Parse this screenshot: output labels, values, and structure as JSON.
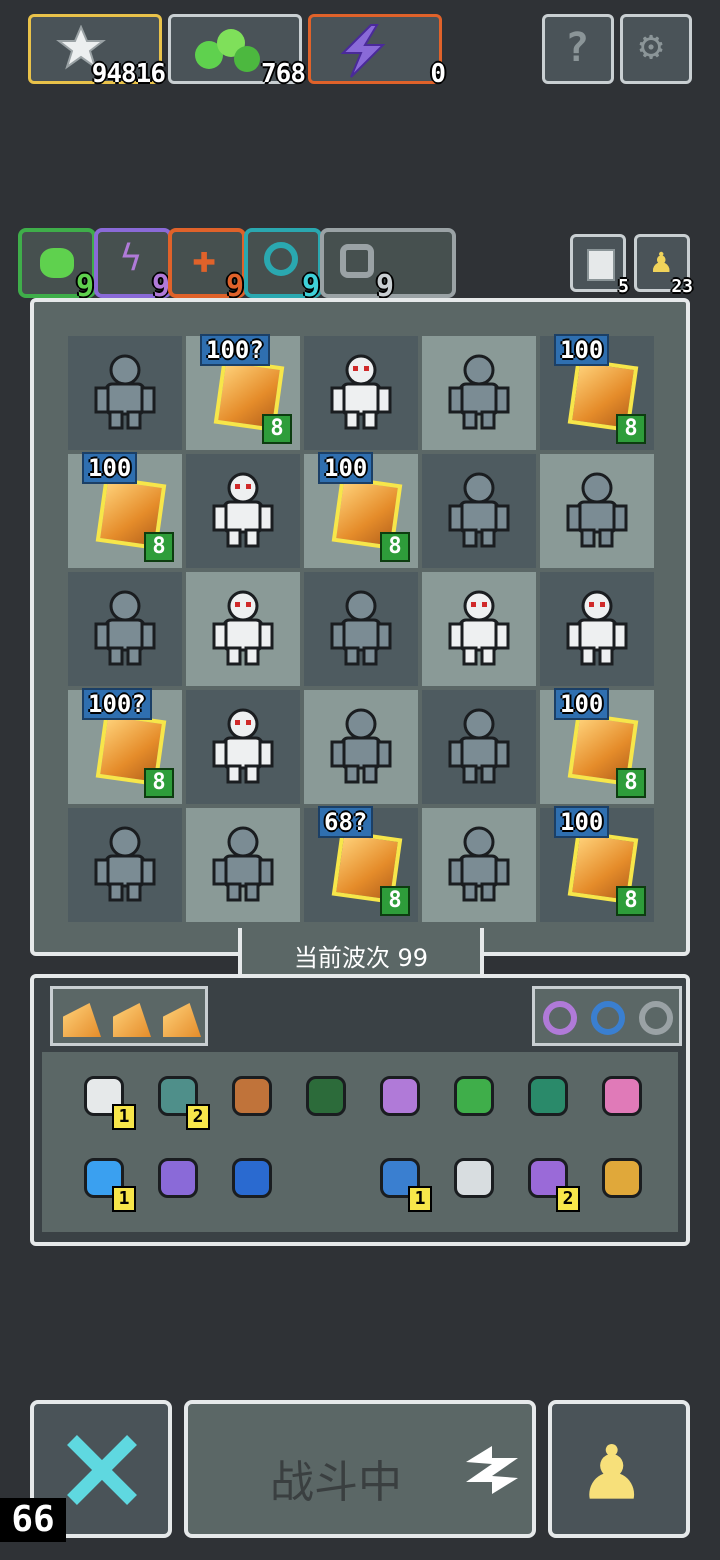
{
  "resources": [
    {
      "icon": "star-icon",
      "value": "94816"
    },
    {
      "icon": "green-blob-icon",
      "value": "768"
    },
    {
      "icon": "lightning-icon",
      "value": "0"
    }
  ],
  "top_buttons": [
    "help-icon",
    "settings-icon"
  ],
  "elements": [
    {
      "icon": "green-element-icon",
      "value": "9",
      "color": "#3fae4a"
    },
    {
      "icon": "purple-lightning-element-icon",
      "value": "9",
      "color": "#8a6ad8"
    },
    {
      "icon": "fire-element-icon",
      "value": "9",
      "color": "#e0622a"
    },
    {
      "icon": "water-element-icon",
      "value": "9",
      "color": "#2aa8b0"
    },
    {
      "icon": "gray-element-icon",
      "value": "9",
      "color": "#9aa2a5"
    }
  ],
  "side_counters": [
    {
      "icon": "scroll-icon",
      "value": "5"
    },
    {
      "icon": "pawn-small-icon",
      "value": "23"
    }
  ],
  "board": {
    "rows": [
      [
        {
          "type": "monster",
          "kind": "dark"
        },
        {
          "type": "crystal",
          "dmg": "100?",
          "lvl": "8"
        },
        {
          "type": "monster",
          "kind": "white"
        },
        {
          "type": "monster",
          "kind": "dark"
        },
        {
          "type": "crystal",
          "dmg": "100",
          "lvl": "8"
        }
      ],
      [
        {
          "type": "crystal",
          "dmg": "100",
          "lvl": "8"
        },
        {
          "type": "monster",
          "kind": "white"
        },
        {
          "type": "crystal",
          "dmg": "100",
          "lvl": "8"
        },
        {
          "type": "monster",
          "kind": "dark"
        },
        {
          "type": "monster",
          "kind": "dark"
        }
      ],
      [
        {
          "type": "monster",
          "kind": "dark"
        },
        {
          "type": "monster",
          "kind": "white"
        },
        {
          "type": "monster",
          "kind": "dark"
        },
        {
          "type": "monster",
          "kind": "white"
        },
        {
          "type": "monster",
          "kind": "white"
        }
      ],
      [
        {
          "type": "crystal",
          "dmg": "100?",
          "lvl": "8"
        },
        {
          "type": "monster",
          "kind": "white"
        },
        {
          "type": "monster",
          "kind": "dark"
        },
        {
          "type": "monster",
          "kind": "dark"
        },
        {
          "type": "crystal",
          "dmg": "100",
          "lvl": "8"
        }
      ],
      [
        {
          "type": "monster",
          "kind": "dark"
        },
        {
          "type": "monster",
          "kind": "dark"
        },
        {
          "type": "crystal",
          "dmg": "68?",
          "lvl": "8"
        },
        {
          "type": "monster",
          "kind": "dark"
        },
        {
          "type": "crystal",
          "dmg": "100",
          "lvl": "8"
        }
      ]
    ],
    "wave_label": "当前波次 99"
  },
  "inventory": {
    "cheese_count": 3,
    "rings": [
      "#b07ad8",
      "#3a7fd0",
      "#9aa2a5"
    ],
    "items_row1": [
      {
        "icon": "bone-icon",
        "count": "1"
      },
      {
        "icon": "heart-gem-icon",
        "count": "2"
      },
      {
        "icon": "feather-icon",
        "count": ""
      },
      {
        "icon": "green-map-icon",
        "count": ""
      },
      {
        "icon": "purple-key-icon",
        "count": ""
      },
      {
        "icon": "green-arrow-icon",
        "count": ""
      },
      {
        "icon": "green-map-2-icon",
        "count": ""
      },
      {
        "icon": "pink-arrow-icon",
        "count": ""
      }
    ],
    "items_row2": [
      {
        "icon": "blue-orb-icon",
        "count": "1"
      },
      {
        "icon": "purple-bat-icon",
        "count": ""
      },
      {
        "icon": "water-drop-icon",
        "count": ""
      },
      {
        "icon": "empty",
        "count": ""
      },
      {
        "icon": "hourglass-icon",
        "count": "1"
      },
      {
        "icon": "silver-stone-icon",
        "count": ""
      },
      {
        "icon": "potion-icon",
        "count": "2"
      },
      {
        "icon": "goblet-icon",
        "count": ""
      }
    ]
  },
  "bottom": {
    "fight_label": "战斗中",
    "fps": "66"
  }
}
